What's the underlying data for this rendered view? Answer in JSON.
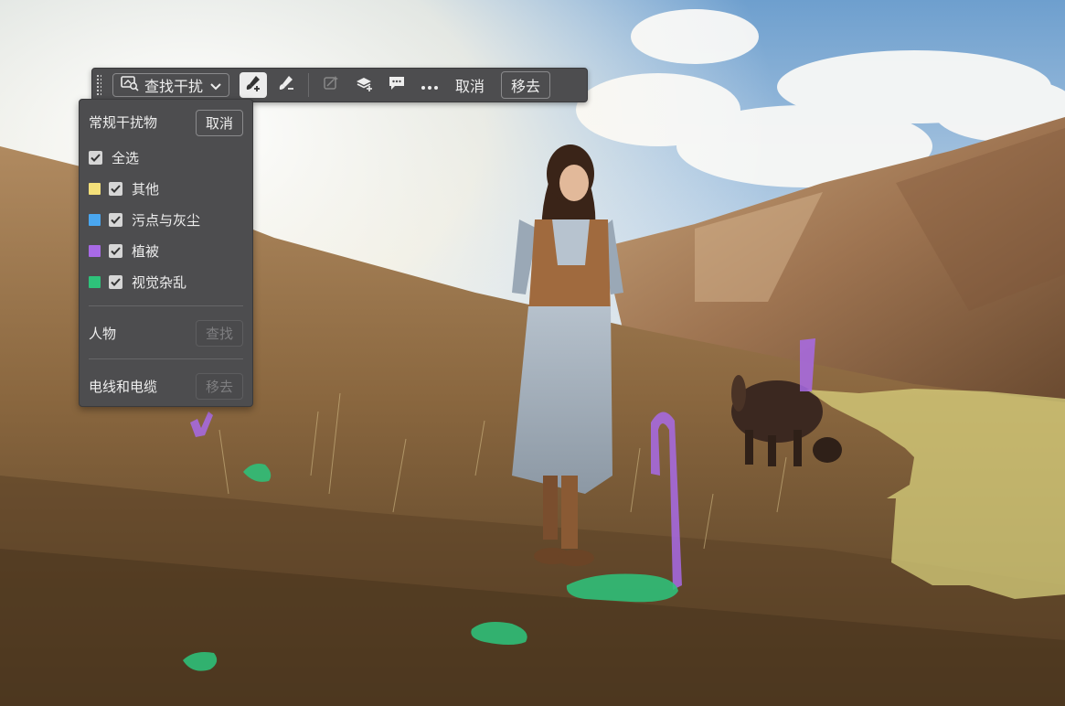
{
  "toolbar": {
    "mode_label": "查找干扰",
    "cancel_label": "取消",
    "remove_label": "移去"
  },
  "panel": {
    "section_title": "常规干扰物",
    "cancel_label": "取消",
    "select_all_label": "全选",
    "categories": [
      {
        "label": "其他",
        "color": "#f4e07a"
      },
      {
        "label": "污点与灰尘",
        "color": "#4aa7f0"
      },
      {
        "label": "植被",
        "color": "#a86ae6"
      },
      {
        "label": "视觉杂乱",
        "color": "#2ec27a"
      }
    ],
    "people_label": "人物",
    "find_label": "查找",
    "wires_label": "电线和电缆",
    "remove_label": "移去"
  },
  "colors": {
    "ui_bg": "#4d4d4f",
    "overlay_other": "#d8d27a",
    "overlay_vegetation": "#a86ae6",
    "overlay_clutter": "#2ec27a"
  }
}
